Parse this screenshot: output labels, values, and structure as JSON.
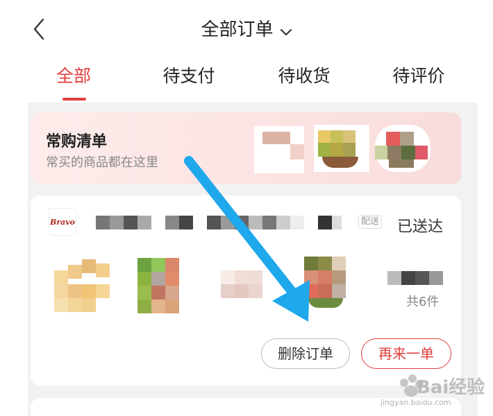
{
  "header": {
    "title": "全部订单",
    "tabs": [
      {
        "label": "全部",
        "active": true
      },
      {
        "label": "待支付",
        "active": false
      },
      {
        "label": "待收货",
        "active": false
      },
      {
        "label": "待评价",
        "active": false
      }
    ]
  },
  "favorites": {
    "title": "常购清单",
    "subtitle": "常买的商品都在这里"
  },
  "order": {
    "delivery_tag": "配送",
    "status": "已送达",
    "item_count": "共6件",
    "delete_button": "删除订单",
    "reorder_button": "再来一单"
  },
  "watermark": {
    "text": "Bai经验",
    "url": "jingyan.baidu.com"
  },
  "colors": {
    "accent": "#e23c3c",
    "arrow": "#1fa8ec"
  }
}
